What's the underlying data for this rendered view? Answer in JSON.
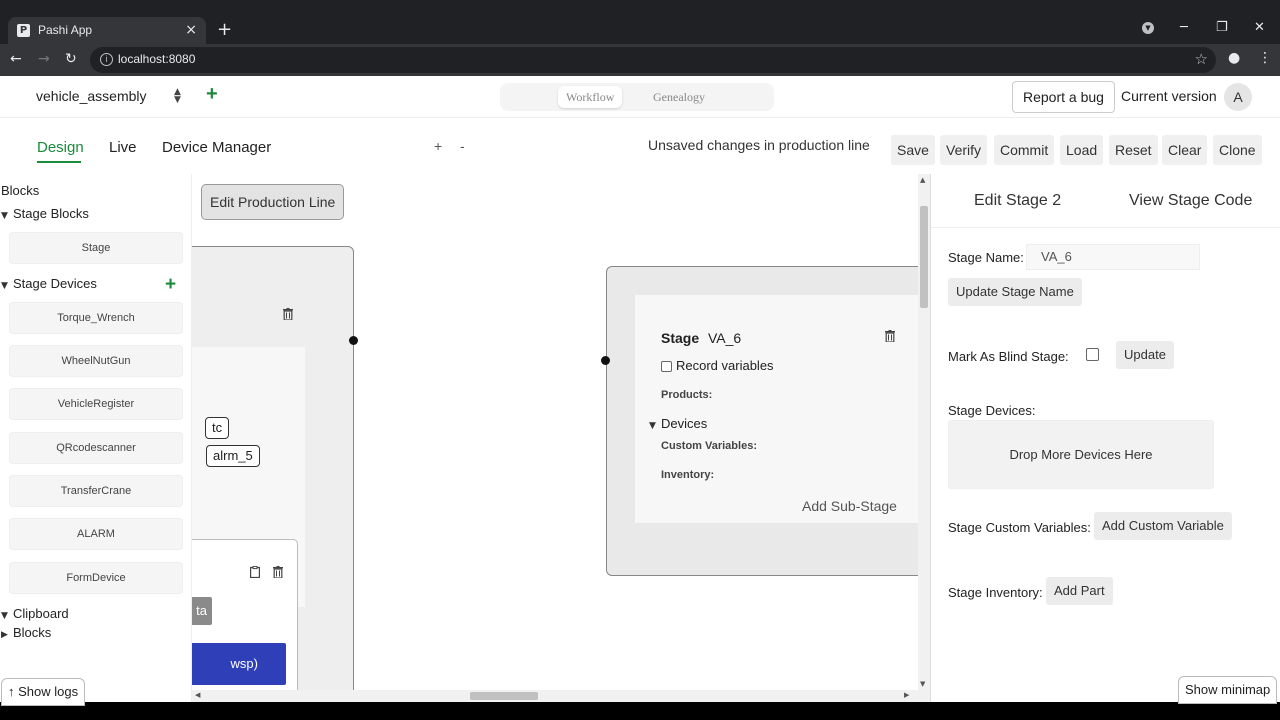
{
  "browser": {
    "tab_title": "Pashi App",
    "favicon_letter": "P",
    "url": "localhost:8080"
  },
  "topbar": {
    "production_line": "vehicle_assembly",
    "view_options": [
      "Workflow",
      "Genealogy"
    ],
    "active_view": "Workflow",
    "report_bug": "Report a bug",
    "current_version": "Current version",
    "avatar_letter": "A"
  },
  "toolbar": {
    "modes": [
      "Design",
      "Live",
      "Device Manager"
    ],
    "active_mode": "Design",
    "zoom_in": "+",
    "zoom_out": "-",
    "status": "Unsaved changes in production line",
    "actions": [
      "Save",
      "Verify",
      "Commit",
      "Load",
      "Reset",
      "Clear",
      "Clone"
    ]
  },
  "sidebar": {
    "title": "Blocks",
    "stage_blocks_heading": "Stage Blocks",
    "stage_blocks": [
      "Stage"
    ],
    "stage_devices_heading": "Stage Devices",
    "stage_devices": [
      "Torque_Wrench",
      "WheelNutGun",
      "VehicleRegister",
      "QRcodescanner",
      "TransferCrane",
      "ALARM",
      "FormDevice"
    ],
    "clipboard_heading": "Clipboard",
    "clipboard_blocks": "Blocks",
    "show_logs": "↑ Show logs"
  },
  "canvas": {
    "edit_production_line": "Edit Production Line",
    "left_stage_chips": [
      "tc",
      "alrm_5"
    ],
    "left_stage_button_ta": "ta",
    "left_stage_button_wsp": "wsp)",
    "stage": {
      "label": "Stage",
      "name": "VA_6",
      "record_variables": "Record variables",
      "products": "Products:",
      "devices": "Devices",
      "custom_variables": "Custom Variables:",
      "inventory": "Inventory:",
      "add_sub_stage": "Add Sub-Stage"
    }
  },
  "panel": {
    "edit_stage": "Edit Stage 2",
    "view_code": "View Stage Code",
    "stage_name_label": "Stage Name:",
    "stage_name_value": "VA_6",
    "update_name": "Update Stage Name",
    "blind_label": "Mark As Blind Stage:",
    "update": "Update",
    "devices_label": "Stage Devices:",
    "drop_devices": "Drop More Devices Here",
    "custom_vars_label": "Stage Custom Variables:",
    "add_custom_var": "Add Custom Variable",
    "inventory_label": "Stage Inventory:",
    "add_part": "Add Part",
    "show_minimap": "Show minimap"
  },
  "colors": {
    "accent_green": "#1b8a3a",
    "button_blue": "#2f3fb8"
  }
}
